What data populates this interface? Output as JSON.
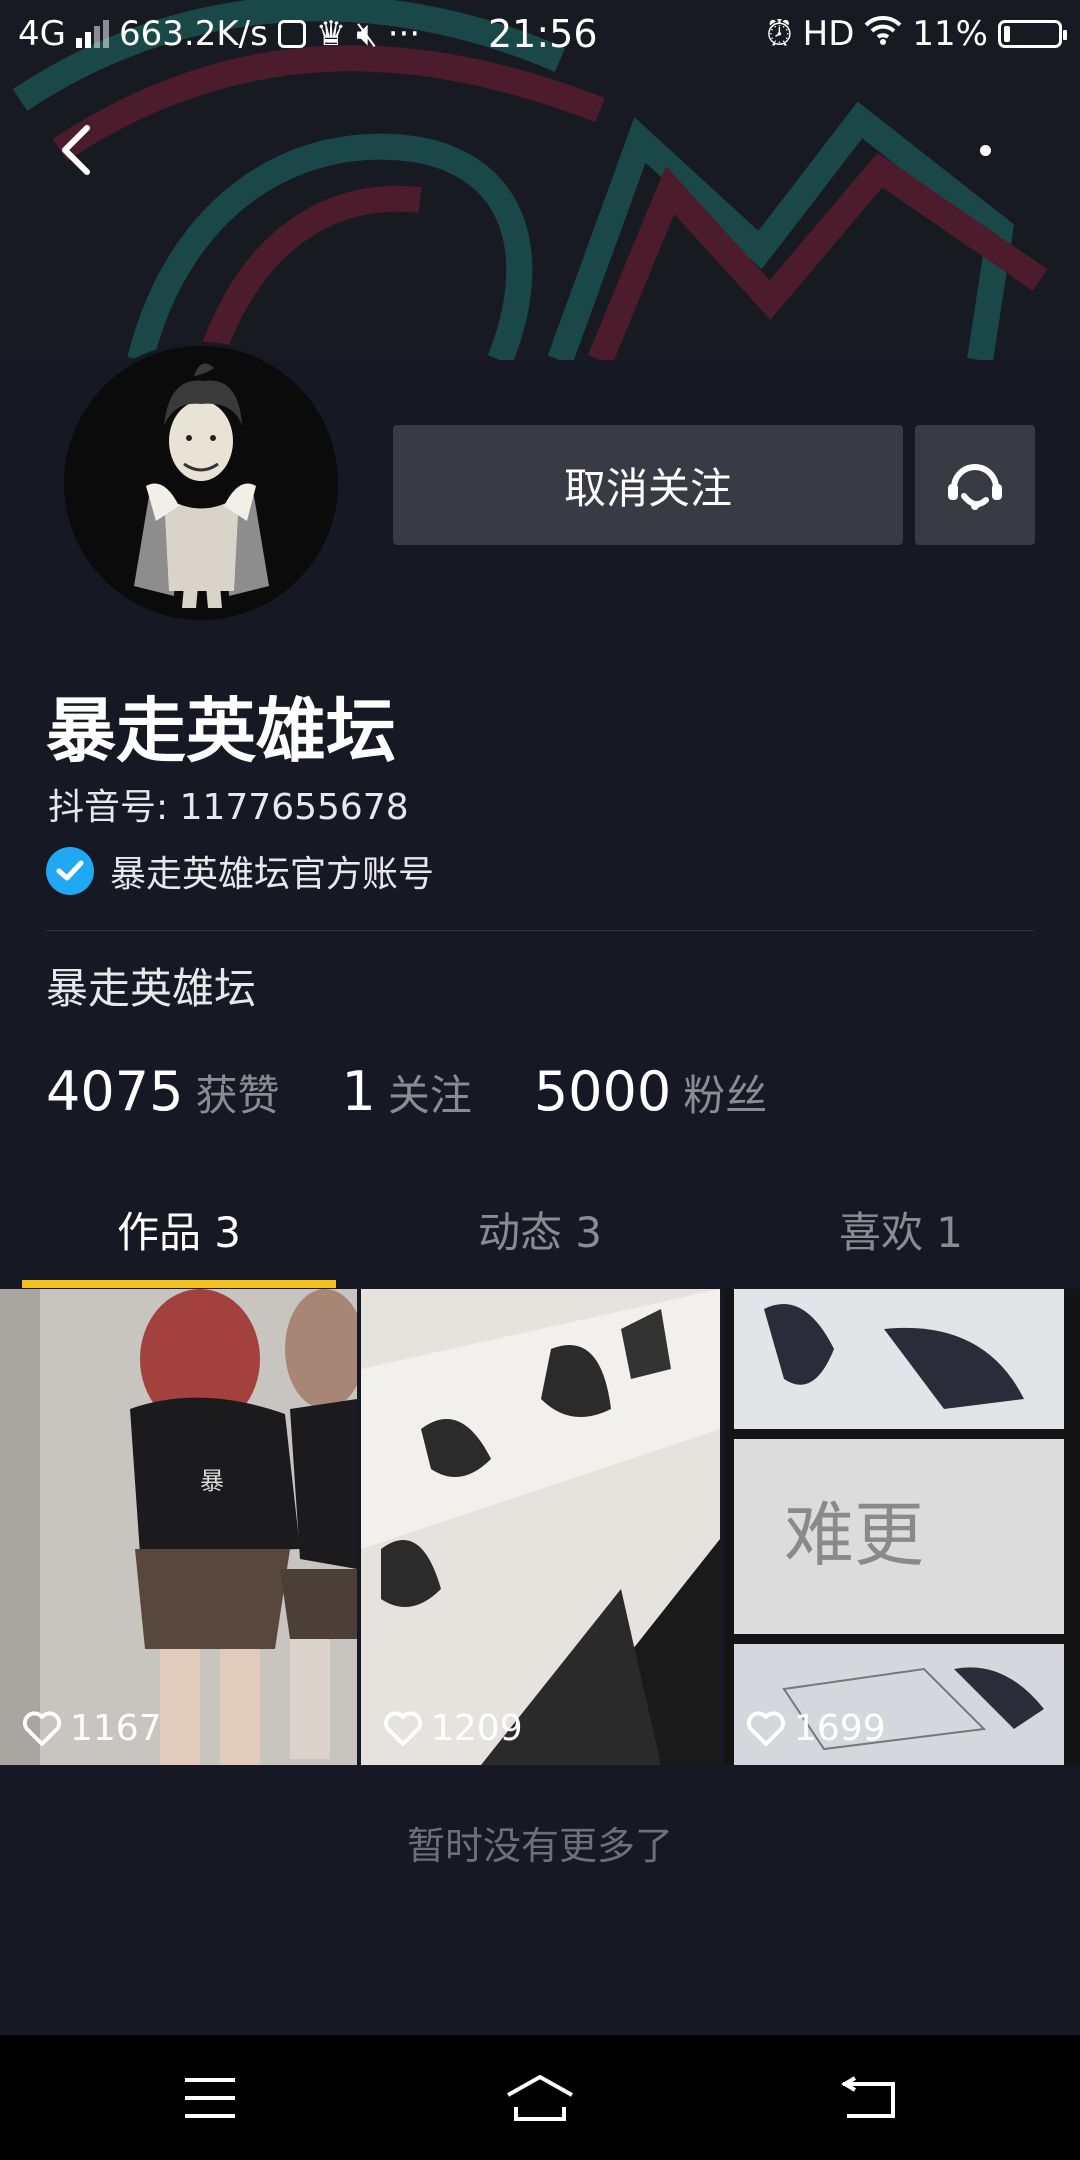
{
  "status_bar": {
    "network": "4G",
    "speed": "663.2K/s",
    "time": "21:56",
    "hd": "HD",
    "battery": "11%",
    "battery_level": 0.11
  },
  "header": {
    "back_icon": "chevron-left-icon",
    "more_icon": "more-dots-icon"
  },
  "profile": {
    "follow_button_label": "取消关注",
    "message_icon": "customer-service-icon",
    "nickname": "暴走英雄坛",
    "douyin_id": "抖音号: 1177655678",
    "verified_text": "暴走英雄坛官方账号",
    "bio": "暴走英雄坛",
    "stats": [
      {
        "value": "4075",
        "label": "获赞"
      },
      {
        "value": "1",
        "label": "关注"
      },
      {
        "value": "5000",
        "label": "粉丝"
      }
    ]
  },
  "tabs": [
    {
      "label": "作品 3",
      "active": true
    },
    {
      "label": "动态 3",
      "active": false
    },
    {
      "label": "喜欢 1",
      "active": false
    }
  ],
  "videos": [
    {
      "likes": "1167"
    },
    {
      "likes": "1209"
    },
    {
      "likes": "1699"
    }
  ],
  "footer_text": "暂时没有更多了",
  "colors": {
    "background": "#161823",
    "button": "#393b44",
    "accent_tab": "#f3c11a",
    "verified": "#20a8f2"
  }
}
